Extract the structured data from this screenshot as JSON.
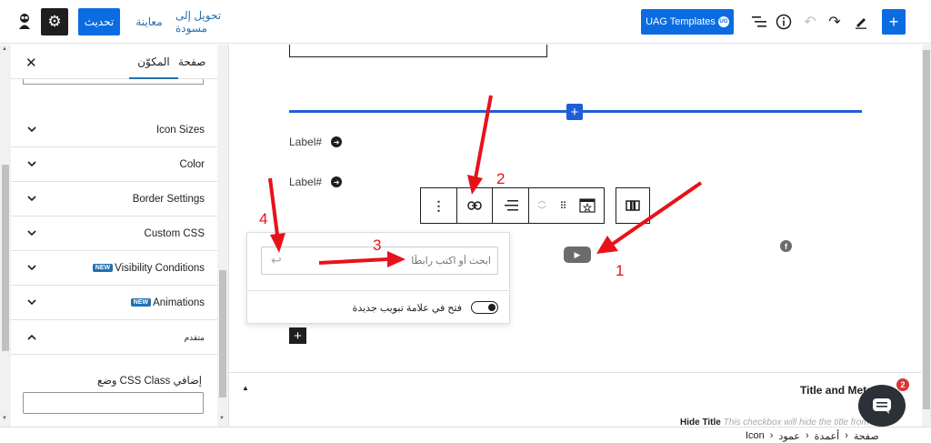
{
  "topbar": {
    "update_label": "تحديث",
    "preview_label": "معاينة",
    "draft_label": "تحويل إلى مسودة",
    "uag_label": "UAG Templates",
    "uag_badge": "UG"
  },
  "sidebar": {
    "tab_block": "المكوّن",
    "tab_page": "صفحة",
    "rows": [
      {
        "label": "Icon Sizes",
        "new": false
      },
      {
        "label": "Color",
        "new": false
      },
      {
        "label": "Border Settings",
        "new": false
      },
      {
        "label": "Custom CSS",
        "new": false
      },
      {
        "label": "Visibility Conditions",
        "new": true
      },
      {
        "label": "Animations",
        "new": true
      },
      {
        "label": "متقدم",
        "new": false
      }
    ],
    "new_badge": "NEW",
    "css_class_label": "وضع CSS Class إضافي",
    "css_class_value": ""
  },
  "canvas": {
    "label1": "Label#",
    "label2": "Label#",
    "link_placeholder": "ابحث أو اكتب رابطًا",
    "new_tab_label": "فتح في علامة تبويب جديدة",
    "annotations": [
      "1",
      "2",
      "3",
      "4"
    ]
  },
  "metabox": {
    "title": "Title and Meta T",
    "hide_title_label": "Hide Title",
    "hide_title_desc": "This checkbox will hide the title from",
    "notification_count": "2"
  },
  "breadcrumb": {
    "items": [
      "صفحة",
      "أعمدة",
      "عمود",
      "Icon"
    ]
  },
  "colors": {
    "accent": "#2271b1",
    "blue_button": "#0a6ce0",
    "annotation_red": "#e8111a",
    "separator_blue": "#1e5fd6"
  }
}
